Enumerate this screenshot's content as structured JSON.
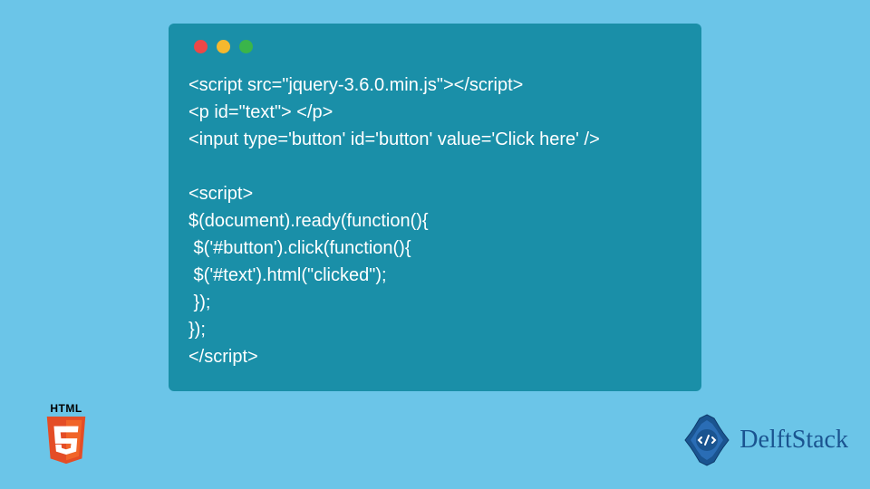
{
  "code": {
    "lines": [
      "<script src=\"jquery-3.6.0.min.js\"></script>",
      "<p id=\"text\"> </p>",
      "<input type='button' id='button' value='Click here' />",
      "",
      "<script>",
      "$(document).ready(function(){",
      " $('#button').click(function(){",
      " $('#text').html(\"clicked\");",
      " });",
      "});",
      "</script>"
    ]
  },
  "html5": {
    "label": "HTML"
  },
  "brand": {
    "name": "DelftStack"
  }
}
